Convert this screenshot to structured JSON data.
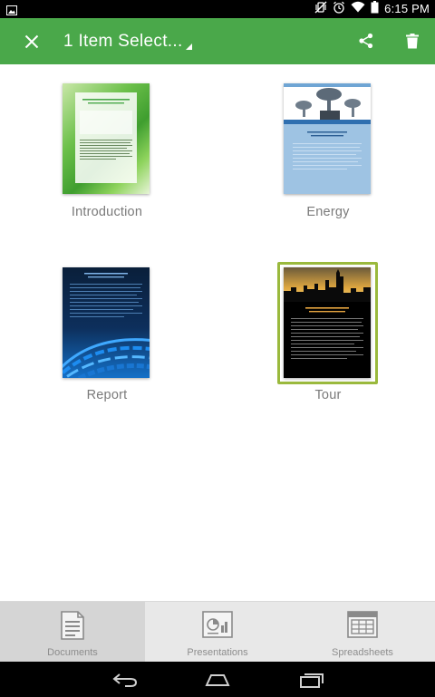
{
  "status_bar": {
    "time": "6:15 PM"
  },
  "action_bar": {
    "title": "1 Item Select...",
    "close_icon": "close-icon",
    "share_icon": "share-icon",
    "delete_icon": "trash-icon",
    "background_color": "#4aa84a"
  },
  "documents": [
    {
      "label": "Introduction",
      "selected": false
    },
    {
      "label": "Energy",
      "selected": false
    },
    {
      "label": "Report",
      "selected": false
    },
    {
      "label": "Tour",
      "selected": true
    }
  ],
  "tabs": [
    {
      "label": "Documents",
      "icon": "document-icon",
      "active": true
    },
    {
      "label": "Presentations",
      "icon": "presentation-icon",
      "active": false
    },
    {
      "label": "Spreadsheets",
      "icon": "spreadsheet-icon",
      "active": false
    }
  ],
  "nav_bar": {
    "back_icon": "back-icon",
    "home_icon": "home-icon",
    "recents_icon": "recents-icon"
  },
  "colors": {
    "accent": "#4aa84a",
    "selection": "#9ab93d"
  }
}
